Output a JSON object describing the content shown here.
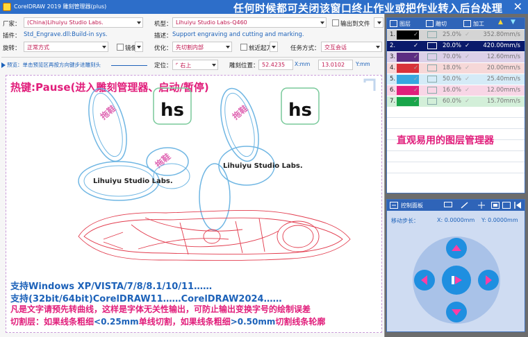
{
  "window": {
    "app_title": "CorelDRAW 2019   雕刻管理器(plus)",
    "notice": "任何时候都可关闭该窗口终止作业或把作业转入后台处理"
  },
  "settings": {
    "vendor_label": "厂家：",
    "vendor_value": "(China)Lihuiyu Studio Labs.",
    "model_label": "机型：",
    "model_value": "Lihuiyu Studio Labs-Q460",
    "output_file_label": "输出到文件",
    "plugin_label": "插件：",
    "plugin_value": "Std_Engrave.dll:Build-in sys.",
    "desc_label": "描述：",
    "desc_value": "Support engraving and cutting and marking.",
    "rotate_label": "旋转：",
    "rotate_value": "正常方式",
    "mirror_label": "镜像",
    "optimize_label": "优化：",
    "optimize_value": "先切割内部",
    "nearest_label": "就近起刀",
    "task_mode_label": "任务方式：",
    "task_mode_value": "交互会话"
  },
  "preview": {
    "hint": "预览：单击预览区再按方向键步进雕刻头",
    "position_label": "定位：",
    "position_value": "右上",
    "engrave_pos_label": "雕刻位置：",
    "x_value": "52.4235",
    "x_unit": "X:mm",
    "y_value": "13.0102",
    "y_unit": "Y:mm"
  },
  "canvas": {
    "hotkey": "热键:Pause(进入雕刻管理器、启动/暂停)",
    "support_os": "支持Windows XP/VISTA/7/8/8.1/10/11……",
    "support_corel": "支持(32bit/64bit)CorelDRAW11……CorelDRAW2024……",
    "text_tip": "凡是文字请预先转曲线，这样是字体无关性输出，可防止输出变换字号的绘制误差",
    "cut_tip_a": "切割层：如果线条粗细",
    "cut_tip_b": "<0.25mm",
    "cut_tip_c": "单线切割，如果线条粗细",
    "cut_tip_d": ">0.50mm",
    "cut_tip_e": "切割线条轮廓",
    "logo_text": "Lihuiyu Studio Labs.",
    "logo_mark": "hs",
    "slipper_text": "拖鞋"
  },
  "layers": {
    "headers": [
      "图层",
      "雕切",
      "加工"
    ],
    "rows": [
      {
        "num": "1.",
        "color": "#000000",
        "pct": "25.0%",
        "speed": "352.80mm/s",
        "bg": "#d4d4d4",
        "text": "#777777"
      },
      {
        "num": "2.",
        "color": "#0a1a6b",
        "pct": "20.0%",
        "speed": "420.00mm/s",
        "bg": "#0a1a6b",
        "text": "#ffffff"
      },
      {
        "num": "3.",
        "color": "#5c2d82",
        "pct": "70.0%",
        "speed": "12.60mm/s",
        "bg": "#dcd0e8",
        "text": "#777777"
      },
      {
        "num": "4.",
        "color": "#d8323a",
        "pct": "18.0%",
        "speed": "20.00mm/s",
        "bg": "#f6d8d8",
        "text": "#777777"
      },
      {
        "num": "5.",
        "color": "#36a7df",
        "pct": "50.0%",
        "speed": "25.40mm/s",
        "bg": "#d5ebf7",
        "text": "#777777"
      },
      {
        "num": "6.",
        "color": "#e11e7b",
        "pct": "16.0%",
        "speed": "12.00mm/s",
        "bg": "#f8d6e6",
        "text": "#777777"
      },
      {
        "num": "7.",
        "color": "#18a54a",
        "pct": "60.0%",
        "speed": "15.70mm/s",
        "bg": "#d3efd9",
        "text": "#777777"
      }
    ],
    "caption": "直观易用的图层管理器"
  },
  "control": {
    "title": "控制面板",
    "step_label": "移动步长：",
    "x_readout": "X: 0.0000mm",
    "y_readout": "Y: 0.0000mm"
  },
  "colors": {
    "accent": "#2f64b8",
    "pink": "#e11e7b",
    "link_blue": "#1d62b9"
  }
}
